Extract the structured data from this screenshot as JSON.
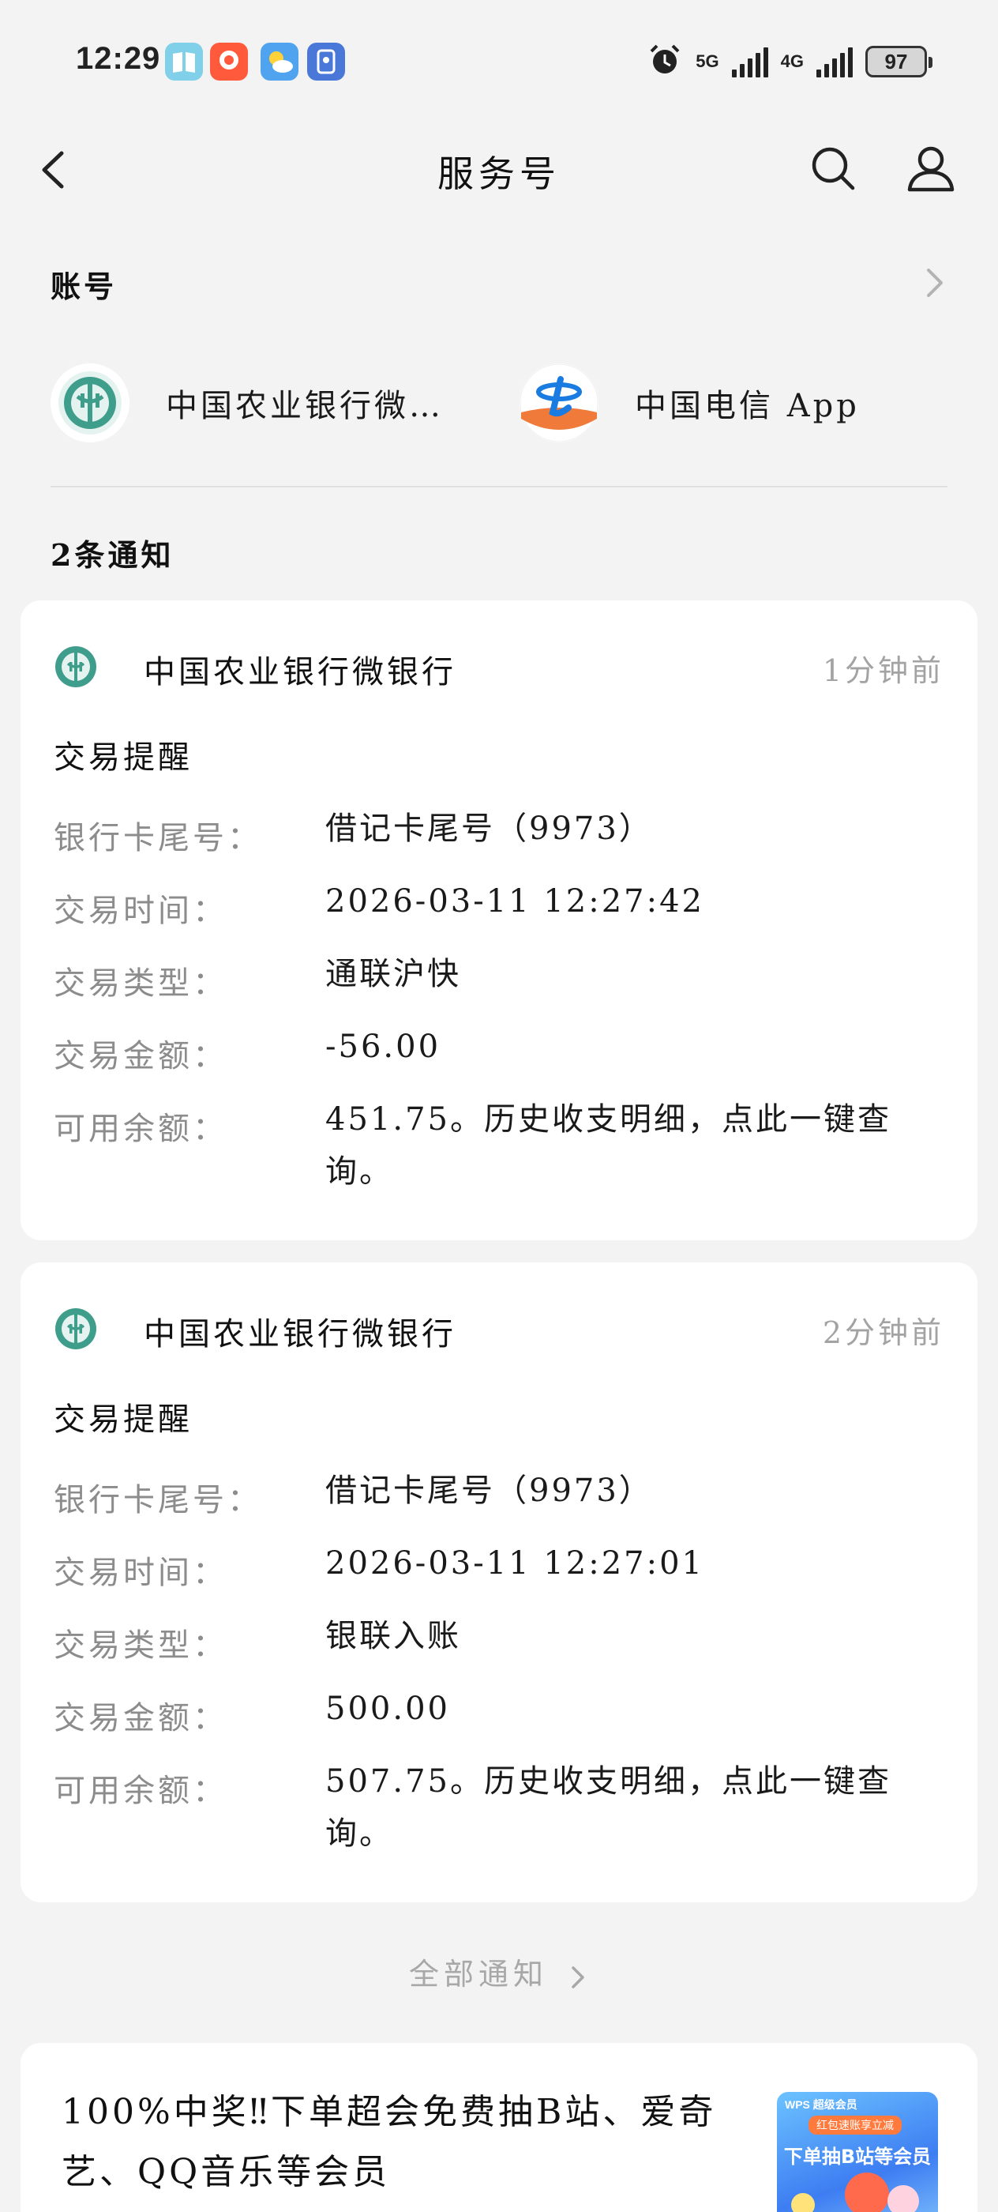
{
  "status_bar": {
    "time": "12:29",
    "net1": "5G",
    "net2": "4G",
    "battery": "97"
  },
  "header": {
    "title": "服务号"
  },
  "accounts": {
    "title": "账号",
    "items": [
      {
        "name": "中国农业银行微…",
        "icon": "abc-bank-logo"
      },
      {
        "name": "中国电信 App",
        "icon": "china-telecom-logo"
      }
    ]
  },
  "notifications": {
    "count_label": "2条通知",
    "cards": [
      {
        "bank": "中国农业银行微银行",
        "time": "1分钟前",
        "subject": "交易提醒",
        "fields": [
          {
            "label": "银行卡尾号：",
            "value": "借记卡尾号（9973）"
          },
          {
            "label": "交易时间：",
            "value": "2026-03-11 12:27:42"
          },
          {
            "label": "交易类型：",
            "value": "通联沪快"
          },
          {
            "label": "交易金额：",
            "value": "-56.00"
          },
          {
            "label": "可用余额：",
            "value": "451.75。历史收支明细，点此一键查询。"
          }
        ]
      },
      {
        "bank": "中国农业银行微银行",
        "time": "2分钟前",
        "subject": "交易提醒",
        "fields": [
          {
            "label": "银行卡尾号：",
            "value": "借记卡尾号（9973）"
          },
          {
            "label": "交易时间：",
            "value": "2026-03-11 12:27:01"
          },
          {
            "label": "交易类型：",
            "value": "银联入账"
          },
          {
            "label": "交易金额：",
            "value": "500.00"
          },
          {
            "label": "可用余额：",
            "value": "507.75。历史收支明细，点此一键查询。"
          }
        ]
      }
    ],
    "all_link": "全部通知"
  },
  "ad": {
    "text": "100%中奖‼下单超会免费抽B站、爱奇艺、QQ音乐等会员",
    "image_tag": "WPS 超级会员",
    "image_pill": "红包速账享立减",
    "image_headline": "下单抽B站等会员"
  },
  "colors": {
    "page_bg": "#f3f3f3",
    "card_bg": "#ffffff",
    "abc_green": "#3f9d8c",
    "telecom_blue": "#1a7be0",
    "muted_text": "#8c8c8c"
  }
}
